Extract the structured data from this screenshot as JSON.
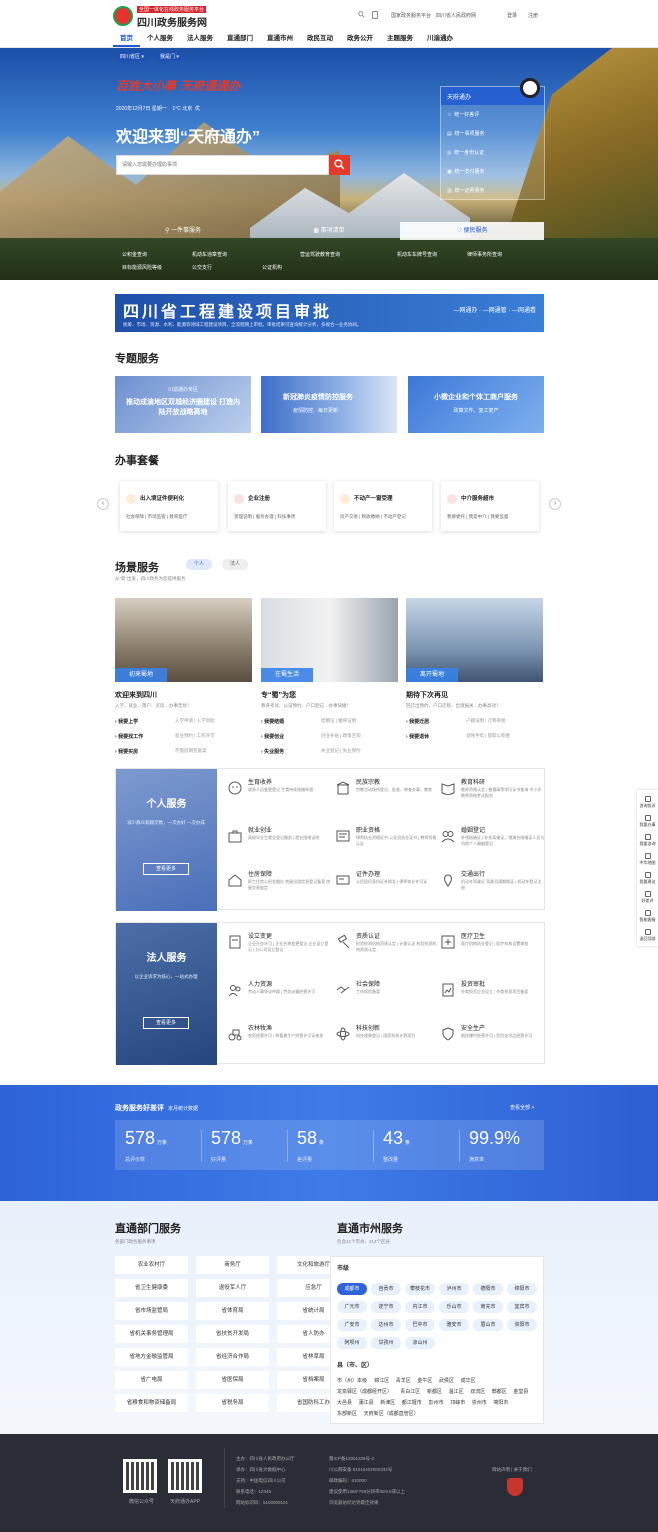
{
  "header": {
    "logo_tagline": "全国一体化在线政务服务平台",
    "logo_title": "四川政务服务网",
    "util_links": [
      "国家政务服务平台",
      "四川省人民政府网"
    ],
    "login": "登录",
    "register": "注册"
  },
  "nav": [
    "首页",
    "个人服务",
    "法人服务",
    "直通部门",
    "直通市州",
    "政民互动",
    "政务公开",
    "主题服务",
    "川渝通办"
  ],
  "hero": {
    "region_select": "四川省区",
    "location_select": "我是门",
    "slogan": "百姓大小事 天府通通办",
    "date": "2020年12月7日 星期一",
    "weather": "1°C 北京",
    "air": "优",
    "welcome": "欢迎来到“天府通办”",
    "search_placeholder": "请输入您需要办理的事项",
    "tianfu_title": "天府通办",
    "tianfu_items": [
      "统一好差评",
      "统一事项服务",
      "统一身份认证",
      "统一支付服务",
      "统一证照服务"
    ],
    "bottom_buttons": [
      "一件事服务",
      "事项清单",
      "便民服务"
    ],
    "links_row1": [
      "公积金查询",
      "机动车违章查询",
      "营运驾驶教育查询",
      "机动车车牌号查询",
      "律师事务所查询"
    ],
    "links_row2": [
      "目标能源风险等级",
      "公交支行",
      "公证机构"
    ]
  },
  "project_banner": {
    "title": "四川省工程建设项目审批",
    "subtitle": "统筹、市场、资源、水利、能源等领域工程建设项目，全流程网上审批，审批结果可查询统计分析，多规合一业务协同。",
    "tagline": "—网通办 · —网通管 · —网通看"
  },
  "topics": {
    "heading": "专题服务",
    "cards": [
      {
        "title": "推动成渝地区双城经济圈建设 打造内陆开放战略高地",
        "sub": "川渝通办专区"
      },
      {
        "title": "新冠肺炎疫情防控服务",
        "sub": "疫情防控、每日更新"
      },
      {
        "title": "小微企业和个体工商户服务",
        "sub": "政策文件、复工复产"
      }
    ]
  },
  "packages": {
    "heading": "办事套餐",
    "cards": [
      {
        "title": "出入境证件便利化",
        "sub": "社会保障 | 市场监管 | 教育医疗"
      },
      {
        "title": "企业注册",
        "sub": "受理说明 | 服务办理 | 科技事项"
      },
      {
        "title": "不动产一窗受理",
        "sub": "房产交易 | 税收缴纳 | 不动产登记"
      },
      {
        "title": "中介服务超市",
        "sub": "我要委托 | 我是中介 | 我要监督"
      }
    ]
  },
  "scenes": {
    "heading": "场景服务",
    "pill_personal": "个人",
    "pill_corp": "法人",
    "sub": "从“新”出发，四川政务为您提供服务",
    "cols": [
      {
        "label": "初来蜀地",
        "title": "欢迎来到四川",
        "sub": "入学、就业、落户、买房…办事无忧！",
        "rows": [
          [
            "我要上学",
            "入学申请 | 入学资助"
          ],
          [
            "我要找工作",
            "就业预约 | 工作许可"
          ],
          [
            "我要买房",
            "存量房网签备案"
          ]
        ]
      },
      {
        "label": "在蜀生活",
        "title": "专“蜀”为您",
        "sub": "教育考试、公证预约、户口登记…办事快捷！",
        "rows": [
          [
            "我要结婚",
            "结婚证 | 婚育证明"
          ],
          [
            "我要创业",
            "创业补贴 | 政策咨询"
          ],
          [
            "失业服务",
            "失业登记 | 失业保险"
          ]
        ]
      },
      {
        "label": "离开蜀地",
        "title": "期待下次再见",
        "sub": "回迁出预约、户口迁移、出境报关…办事高效！",
        "rows": [
          [
            "我要迁居",
            "户籍证明 | 迁移审批"
          ],
          [
            "我要退休",
            "退休手续 | 提取公积金"
          ]
        ]
      }
    ]
  },
  "personal_service": {
    "title": "个人服务",
    "sub": "减少群众跑腿次数，一次办好 一次办成",
    "more": "查看更多",
    "items": [
      {
        "t": "生育收养",
        "s": "收养人员变更登记 生育持续结婚年限"
      },
      {
        "t": "民族宗教",
        "s": "宗教活动场所登记、批准、审查办事、教育"
      },
      {
        "t": "教育科研",
        "s": "教师资格认定 | 普通高等学历证书查询 中小学教师资格考试报名"
      },
      {
        "t": "就业创业",
        "s": "高校毕业生就业登记服务 | 就业困难证明"
      },
      {
        "t": "职业资格",
        "s": "律师执业资格证书 公证员执业证书 | 教师资格认证"
      },
      {
        "t": "婚姻登记",
        "s": "补领结婚证 | 补发离婚证、港澳台结婚证人员与内地个人婚姻登记"
      },
      {
        "t": "住房保障",
        "s": "职工住房公积金缴存 房屋出租信息登记备案 房屋交易鉴定"
      },
      {
        "t": "证件办理",
        "s": "公民居民身份证补换发 | 律师执业许可证"
      },
      {
        "t": "交通出行",
        "s": "机动车驾驶证 驾驶员满期换证 | 机动车登记注册"
      }
    ]
  },
  "corp_service": {
    "title": "法人服务",
    "sub": "以企业诉求为核心，一站式办理",
    "more": "查看更多",
    "items": [
      {
        "t": "设立变更",
        "s": "企业开办许可 | 企业名称变更登记 企业设立登记 | 分公司设立登记"
      },
      {
        "t": "资质认证",
        "s": "检验检测机构资质认定 | 计量认证 检验检测机构资质认定"
      },
      {
        "t": "医疗卫生",
        "s": "医疗机构执业登记 | 医疗机构设置审批"
      },
      {
        "t": "人力资源",
        "s": "劳动人事争议仲裁 | 劳务派遣经营许可"
      },
      {
        "t": "社会保障",
        "s": "工伤保险备案"
      },
      {
        "t": "投资审批",
        "s": "外商投资企业设立 | 外商投资项目备案"
      },
      {
        "t": "农林牧渔",
        "s": "农药经营许可 | 种畜禽生产经营许可证核发"
      },
      {
        "t": "科技创新",
        "s": "科技成果登记 | 国家科技计划项目"
      },
      {
        "t": "安全生产",
        "s": "烟花爆竹经营许可 | 危险化学品经营许可"
      }
    ]
  },
  "stats": {
    "heading": "政务服务好差评",
    "heading_sub": "本月统计数据",
    "more": "查看全部 >",
    "items": [
      {
        "n": "578",
        "u": "万条",
        "l": "总评价数"
      },
      {
        "n": "578",
        "u": "万条",
        "l": "好评量"
      },
      {
        "n": "58",
        "u": "条",
        "l": "差评量"
      },
      {
        "n": "43",
        "u": "条",
        "l": "整改量"
      },
      {
        "n": "99.9%",
        "u": "",
        "l": "满意率"
      }
    ]
  },
  "departments": {
    "heading": "直通部门服务",
    "sub": "各部门政务服务事项",
    "items": [
      "农业农村厅",
      "商务厅",
      "文化和旅游厅",
      "省卫生健康委",
      "退役军人厅",
      "应急厅",
      "省市场监管局",
      "省体育局",
      "省统计局",
      "省机关事务管理局",
      "省扶贫开发局",
      "省人防办",
      "省地方金融监管局",
      "省经济合作局",
      "省林草局",
      "省广电局",
      "省医保局",
      "省档案局",
      "省粮食和物资储备局",
      "省税务局",
      "省国防科工办"
    ]
  },
  "cities": {
    "heading": "直通市州服务",
    "sub": "包含21个市州、214个区县",
    "city_label": "市级",
    "cities": [
      "成都市",
      "自贡市",
      "攀枝花市",
      "泸州市",
      "德阳市",
      "绵阳市",
      "广元市",
      "遂宁市",
      "内江市",
      "乐山市",
      "南充市",
      "宜宾市",
      "广安市",
      "达州市",
      "巴中市",
      "雅安市",
      "眉山市",
      "资阳市",
      "阿坝州",
      "甘孜州",
      "凉山州"
    ],
    "county_label": "县（市、区）",
    "counties": [
      "市（州）本级",
      "锦江区",
      "青羊区",
      "金牛区",
      "武侯区",
      "成华区",
      "龙泉驿区（成都经开区）",
      "青白江区",
      "新都区",
      "温江区",
      "双流区",
      "郫都区",
      "金堂县",
      "大邑县",
      "蒲江县",
      "新津区",
      "都江堰市",
      "彭州市",
      "邛崃市",
      "崇州市",
      "简阳市",
      "东部新区",
      "天府新区（成都直管区）"
    ]
  },
  "footer": {
    "qr1": "微信公众号",
    "qr2": "天府通办APP",
    "col1": [
      "主办：四川省人民政府办公厅",
      "承办：四川省大数据中心",
      "支持：中国电信四川公司",
      "联系电话：12345",
      "网站标识码：5100000101"
    ],
    "col2": [
      "蜀ICP备12001205号-3",
      "川公网安备 51010402000332号",
      "邮政编码：610000",
      "建议使用1366*768分辨率/IE9.0或以上",
      "浏览器访问达到最佳效果"
    ],
    "right_links": "网站声明 | 关于我们"
  },
  "side_float": [
    "咨询投诉",
    "我要办事",
    "我要咨询",
    "中华地图",
    "我要建议",
    "好差评",
    "智能客服",
    "返回顶部"
  ],
  "colors": {
    "primary": "#2e63d9",
    "accent": "#e23b2b",
    "footer": "#2a2d36"
  }
}
